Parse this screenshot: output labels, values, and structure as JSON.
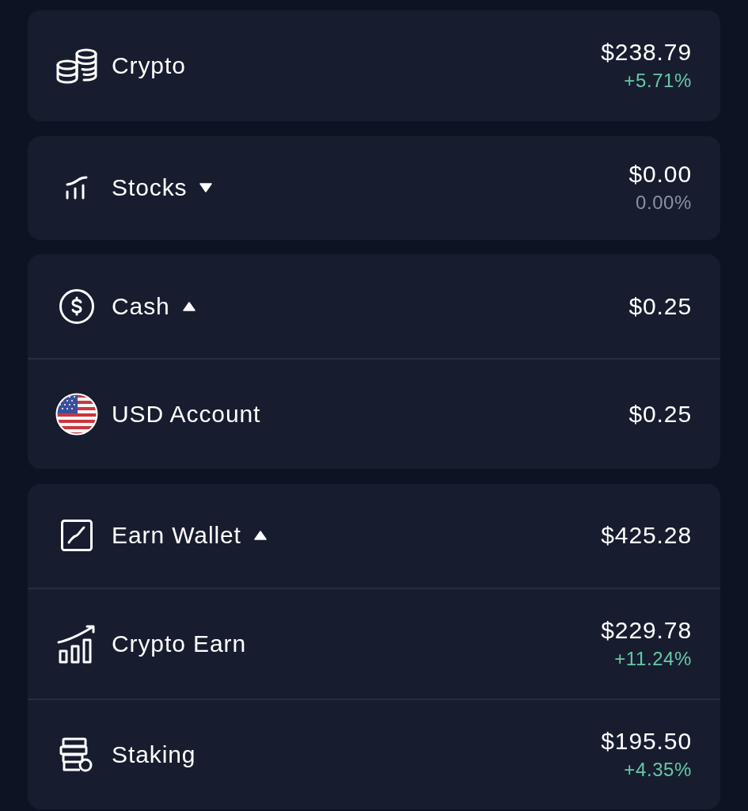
{
  "accounts": [
    {
      "kind": "crypto",
      "label": "Crypto",
      "value": "$238.79",
      "change": "+5.71%",
      "gain": true
    },
    {
      "kind": "stocks",
      "label": "Stocks",
      "expanded": false,
      "value": "$0.00",
      "change": "0.00%",
      "gain": false
    },
    {
      "kind": "cash",
      "label": "Cash",
      "expanded": true,
      "value": "$0.25",
      "children": [
        {
          "kind": "currency",
          "label": "USD Account",
          "value": "$0.25"
        }
      ]
    },
    {
      "kind": "earn",
      "label": "Earn Wallet",
      "expanded": true,
      "value": "$425.28",
      "children": [
        {
          "kind": "yield",
          "label": "Crypto Earn",
          "value": "$229.78",
          "change": "+11.24%",
          "gain": true
        },
        {
          "kind": "staking",
          "label": "Staking",
          "value": "$195.50",
          "change": "+4.35%",
          "gain": true
        }
      ]
    }
  ]
}
